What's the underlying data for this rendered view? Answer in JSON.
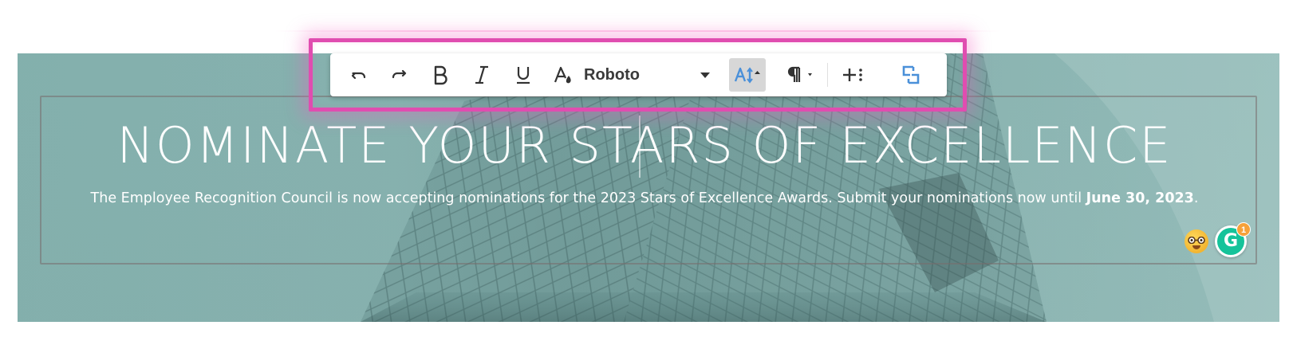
{
  "toolbar": {
    "font_family_value": "Roboto",
    "buttons": [
      "undo",
      "redo",
      "bold",
      "italic",
      "underline",
      "text-color",
      "font-family",
      "font-size",
      "paragraph-format",
      "insert-more",
      "toggle-fullscreen"
    ]
  },
  "banner": {
    "headline": "NOMINATE YOUR STARS OF EXCELLENCE",
    "subline_prefix": "The Employee Recognition Council is now accepting nominations for the 2023 Stars of Excellence Awards. Submit your nominations now until ",
    "subline_date": "June 30, 2023",
    "subline_suffix": "."
  },
  "grammarly": {
    "letter": "G",
    "badge_count": "1"
  },
  "colors": {
    "highlight": "#e04db0",
    "banner_teal": "#86b1ae",
    "active_blue": "#4a90d9",
    "grammarly_green": "#15c39a",
    "badge_orange": "#f6a13a"
  }
}
